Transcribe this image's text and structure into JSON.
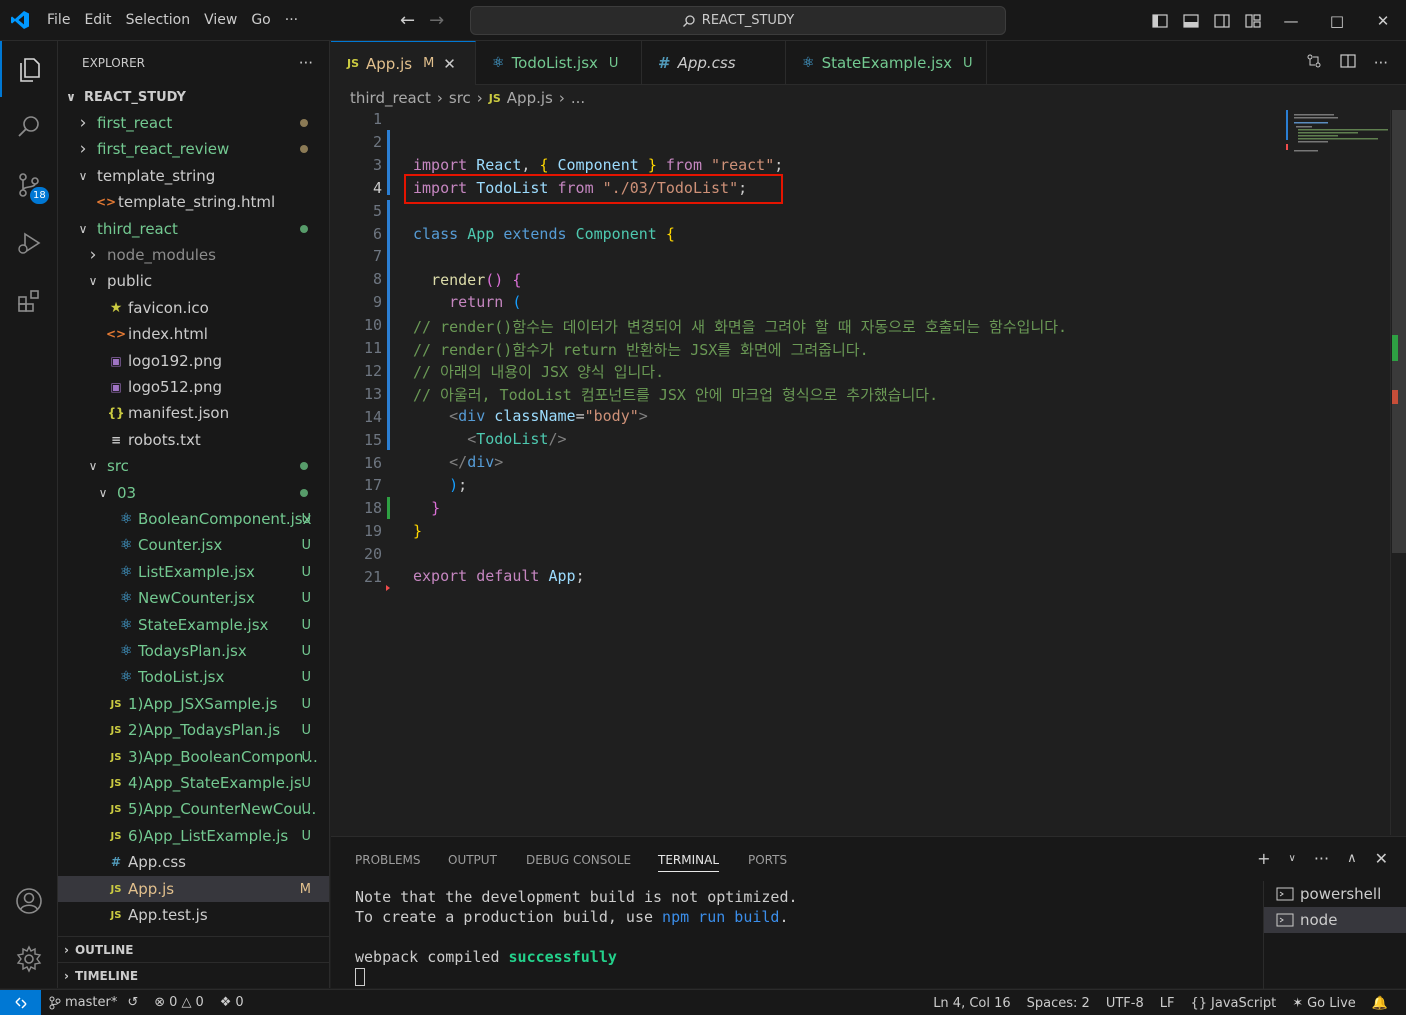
{
  "titlebar": {
    "menus": [
      "File",
      "Edit",
      "Selection",
      "View",
      "Go"
    ],
    "more": "···",
    "search_text": "REACT_STUDY"
  },
  "activity": {
    "scm_badge": "18"
  },
  "explorer": {
    "header": "EXPLORER",
    "more": "···",
    "root": "REACT_STUDY",
    "items": [
      {
        "label": "first_react",
        "kind": "folder-collapsed",
        "depth": 0,
        "color": "#73c991",
        "dot": "#8b7a55"
      },
      {
        "label": "first_react_review",
        "kind": "folder-collapsed",
        "depth": 0,
        "color": "#73c991",
        "dot": "#8b7a55"
      },
      {
        "label": "template_string",
        "kind": "folder-open",
        "depth": 0,
        "color": "#cccccc"
      },
      {
        "label": "template_string.html",
        "kind": "html",
        "depth": 1,
        "color": "#cccccc"
      },
      {
        "label": "third_react",
        "kind": "folder-open",
        "depth": 0,
        "color": "#73c991",
        "dot": "#579c6a"
      },
      {
        "label": "node_modules",
        "kind": "folder-collapsed",
        "depth": 1,
        "color": "#8c8c8c"
      },
      {
        "label": "public",
        "kind": "folder-open",
        "depth": 1,
        "color": "#cccccc"
      },
      {
        "label": "favicon.ico",
        "kind": "star",
        "depth": 2,
        "color": "#cccccc"
      },
      {
        "label": "index.html",
        "kind": "html",
        "depth": 2,
        "color": "#cccccc"
      },
      {
        "label": "logo192.png",
        "kind": "image",
        "depth": 2,
        "color": "#cccccc"
      },
      {
        "label": "logo512.png",
        "kind": "image",
        "depth": 2,
        "color": "#cccccc"
      },
      {
        "label": "manifest.json",
        "kind": "json",
        "depth": 2,
        "color": "#cccccc"
      },
      {
        "label": "robots.txt",
        "kind": "text",
        "depth": 2,
        "color": "#cccccc"
      },
      {
        "label": "src",
        "kind": "folder-open",
        "depth": 1,
        "color": "#73c991",
        "dot": "#579c6a"
      },
      {
        "label": "03",
        "kind": "folder-open",
        "depth": 2,
        "color": "#73c991",
        "dot": "#579c6a"
      },
      {
        "label": "BooleanComponent.jsx",
        "kind": "react",
        "depth": 3,
        "color": "#73c991",
        "status": "U"
      },
      {
        "label": "Counter.jsx",
        "kind": "react",
        "depth": 3,
        "color": "#73c991",
        "status": "U"
      },
      {
        "label": "ListExample.jsx",
        "kind": "react",
        "depth": 3,
        "color": "#73c991",
        "status": "U"
      },
      {
        "label": "NewCounter.jsx",
        "kind": "react",
        "depth": 3,
        "color": "#73c991",
        "status": "U"
      },
      {
        "label": "StateExample.jsx",
        "kind": "react",
        "depth": 3,
        "color": "#73c991",
        "status": "U"
      },
      {
        "label": "TodaysPlan.jsx",
        "kind": "react",
        "depth": 3,
        "color": "#73c991",
        "status": "U"
      },
      {
        "label": "TodoList.jsx",
        "kind": "react",
        "depth": 3,
        "color": "#73c991",
        "status": "U"
      },
      {
        "label": "1)App_JSXSample.js",
        "kind": "js",
        "depth": 2,
        "color": "#73c991",
        "status": "U"
      },
      {
        "label": "2)App_TodaysPlan.js",
        "kind": "js",
        "depth": 2,
        "color": "#73c991",
        "status": "U"
      },
      {
        "label": "3)App_BooleanCompon...",
        "kind": "js",
        "depth": 2,
        "color": "#73c991",
        "status": "U"
      },
      {
        "label": "4)App_StateExample.js",
        "kind": "js",
        "depth": 2,
        "color": "#73c991",
        "status": "U"
      },
      {
        "label": "5)App_CounterNewCou...",
        "kind": "js",
        "depth": 2,
        "color": "#73c991",
        "status": "U"
      },
      {
        "label": "6)App_ListExample.js",
        "kind": "js",
        "depth": 2,
        "color": "#73c991",
        "status": "U"
      },
      {
        "label": "App.css",
        "kind": "css",
        "depth": 2,
        "color": "#cccccc"
      },
      {
        "label": "App.js",
        "kind": "js",
        "depth": 2,
        "color": "#e2c08d",
        "status": "M",
        "selected": true
      },
      {
        "label": "App.test.js",
        "kind": "js",
        "depth": 2,
        "color": "#cccccc"
      }
    ],
    "outline": "OUTLINE",
    "timeline": "TIMELINE"
  },
  "tabs": [
    {
      "label": "App.js",
      "icon": "js",
      "status": "M",
      "active": true,
      "color": "#e2c08d"
    },
    {
      "label": "TodoList.jsx",
      "icon": "react",
      "status": "U",
      "color": "#73c991"
    },
    {
      "label": "App.css",
      "icon": "css",
      "status": "",
      "color": "#cccccc",
      "italic": true
    },
    {
      "label": "StateExample.jsx",
      "icon": "react",
      "status": "U",
      "color": "#73c991"
    }
  ],
  "breadcrumb": [
    "third_react",
    "src",
    "App.js",
    "..."
  ],
  "code": {
    "current_line": 4,
    "line_numbers": [
      "1",
      "2",
      "3",
      "4",
      "5",
      "6",
      "7",
      "8",
      "9",
      "10",
      "11",
      "12",
      "13",
      "14",
      "15",
      "16",
      "17",
      "18",
      "19",
      "20",
      "21"
    ],
    "line3": {
      "kw": "import",
      "a": "React",
      "b": "Component",
      "from": "from",
      "str": "\"react\""
    },
    "line4": {
      "kw": "import",
      "a": "TodoList",
      "from": "from",
      "str": "\"./03/TodoList\""
    },
    "line6": {
      "kw1": "class",
      "name": "App",
      "kw2": "extends",
      "base": "Component"
    },
    "line8": {
      "fn": "render"
    },
    "line9": {
      "kw": "return"
    },
    "comments": [
      "// render()함수는 데이터가 변경되어 새 화면을 그려야 할 때 자동으로 호출되는 함수입니다.",
      "// render()함수가 return 반환하는 JSX를 화면에 그려줍니다.",
      "// 아래의 내용이 JSX 양식 입니다.",
      "// 아울러, TodoList 컴포넌트를 JSX 안에 마크업 형식으로 추가했습니다."
    ],
    "line14": {
      "tag": "div",
      "attr": "className",
      "val": "\"body\""
    },
    "line15": {
      "tag": "TodoList"
    },
    "line16": {
      "tag": "div"
    },
    "line21": {
      "kw1": "export",
      "kw2": "default",
      "name": "App"
    }
  },
  "panel": {
    "tabs": [
      "PROBLEMS",
      "OUTPUT",
      "DEBUG CONSOLE",
      "TERMINAL",
      "PORTS"
    ],
    "active_tab": "TERMINAL",
    "terminal": {
      "line1": "Note that the development build is not optimized.",
      "line2_a": "To create a production build, use ",
      "line2_b": "npm run build",
      "line2_c": ".",
      "line3_a": "webpack compiled ",
      "line3_b": "successfully"
    },
    "terminals": [
      "powershell",
      "node"
    ],
    "selected_terminal": "node"
  },
  "statusbar": {
    "branch": "master*",
    "errors": "0",
    "warnings": "0",
    "ports": "0",
    "position": "Ln 4, Col 16",
    "spaces": "Spaces: 2",
    "encoding": "UTF-8",
    "eol": "LF",
    "language": "JavaScript",
    "golive": "Go Live"
  }
}
